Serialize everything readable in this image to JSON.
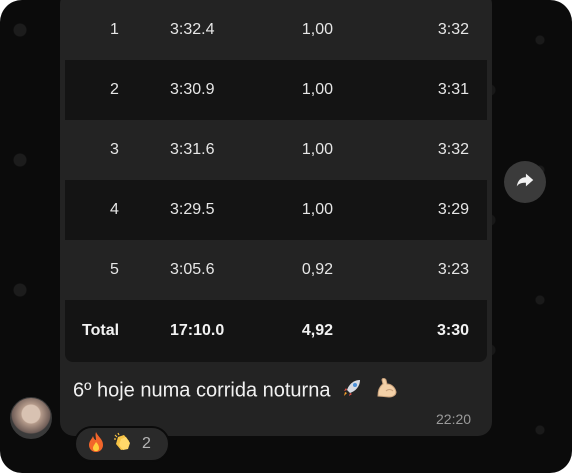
{
  "laps_table": {
    "rows": [
      {
        "lap": "1",
        "time": "3:32.4",
        "distance": "1,00",
        "pace": "3:32"
      },
      {
        "lap": "2",
        "time": "3:30.9",
        "distance": "1,00",
        "pace": "3:31"
      },
      {
        "lap": "3",
        "time": "3:31.6",
        "distance": "1,00",
        "pace": "3:32"
      },
      {
        "lap": "4",
        "time": "3:29.5",
        "distance": "1,00",
        "pace": "3:29"
      },
      {
        "lap": "5",
        "time": "3:05.6",
        "distance": "0,92",
        "pace": "3:23"
      }
    ],
    "total": {
      "label": "Total",
      "time": "17:10.0",
      "distance": "4,92",
      "pace": "3:30"
    }
  },
  "message": {
    "caption": "6º hoje numa corrida noturna",
    "caption_emojis": [
      "rocket-emoji",
      "flexed-biceps-emoji"
    ],
    "timestamp": "22:20"
  },
  "reactions": {
    "emojis": [
      "fire-emoji",
      "clapping-hands-emoji"
    ],
    "count": "2"
  },
  "icons": {
    "forward": "forward-arrow-icon",
    "avatar": "user-avatar"
  },
  "colors": {
    "background": "#0b0b0b",
    "bubble": "#232323",
    "row_dark": "#141414",
    "row_light": "#232323",
    "text": "#e6e6e6",
    "timestamp": "#9a9a9a"
  }
}
